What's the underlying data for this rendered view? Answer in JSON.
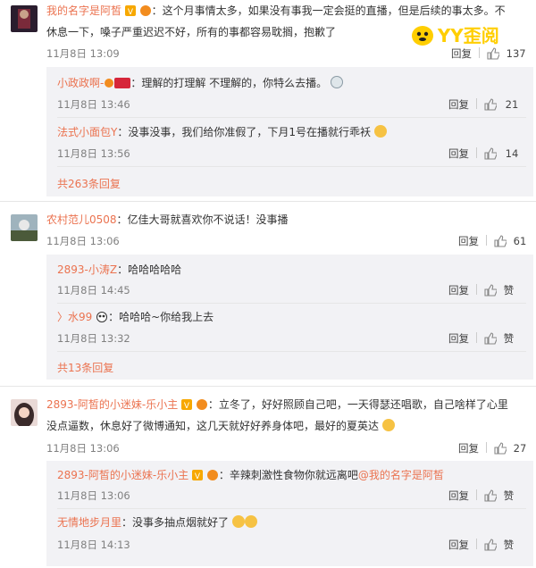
{
  "watermark": {
    "logo_text": "YY歪阅"
  },
  "labels": {
    "reply": "回复",
    "like": "赞"
  },
  "comments": [
    {
      "user": "我的名字是阿皙",
      "text1": "：这个月事情太多，如果没有事我一定会挺的直播，但是后续的事太多。不",
      "text2": "休息一下，嗓子严重迟迟不好，所有的事都容易耽搁，抱歉了",
      "time": "11月8日 13:09",
      "likes": "137",
      "replies": [
        {
          "user": "小政政啊-",
          "text": "：理解的打理解 不理解的，你特么去播。",
          "time": "11月8日 13:46",
          "likes": "21"
        },
        {
          "user": "法式小面包Y",
          "text": "：没事没事，我们给你准假了，下月1号在播就行乖袄",
          "time": "11月8日 13:56",
          "likes": "14"
        }
      ],
      "more": "共263条回复"
    },
    {
      "user": "农村范儿0508",
      "text1": "：亿佳大哥就喜欢你不说话！没事播",
      "time": "11月8日 13:06",
      "likes": "61",
      "replies": [
        {
          "user": "2893-小涛Z",
          "text": "：哈哈哈哈哈",
          "time": "11月8日 14:45",
          "likes": "赞"
        },
        {
          "user": "〉水99",
          "text": "：哈哈哈~你给我上去",
          "time": "11月8日 13:32",
          "likes": "赞"
        }
      ],
      "more": "共13条回复"
    },
    {
      "user": "2893-阿皙的小迷妹-乐小主",
      "text1": "：立冬了，好好照顾自己吧，一天得瑟还唱歌，自己啥样了心里",
      "text2": "没点逼数，休息好了微博通知，这几天就好好养身体吧，最好的夏英达",
      "time": "11月8日 13:06",
      "likes": "27",
      "replies": [
        {
          "user": "2893-阿皙的小迷妹-乐小主",
          "text": "：辛辣刺激性食物你就远离吧",
          "mention": "@我的名字是阿皙",
          "time": "11月8日 13:06",
          "likes": "赞"
        },
        {
          "user": "无情地步月里",
          "text": "：没事多抽点烟就好了",
          "time": "11月8日 14:13",
          "likes": "赞"
        }
      ]
    }
  ]
}
